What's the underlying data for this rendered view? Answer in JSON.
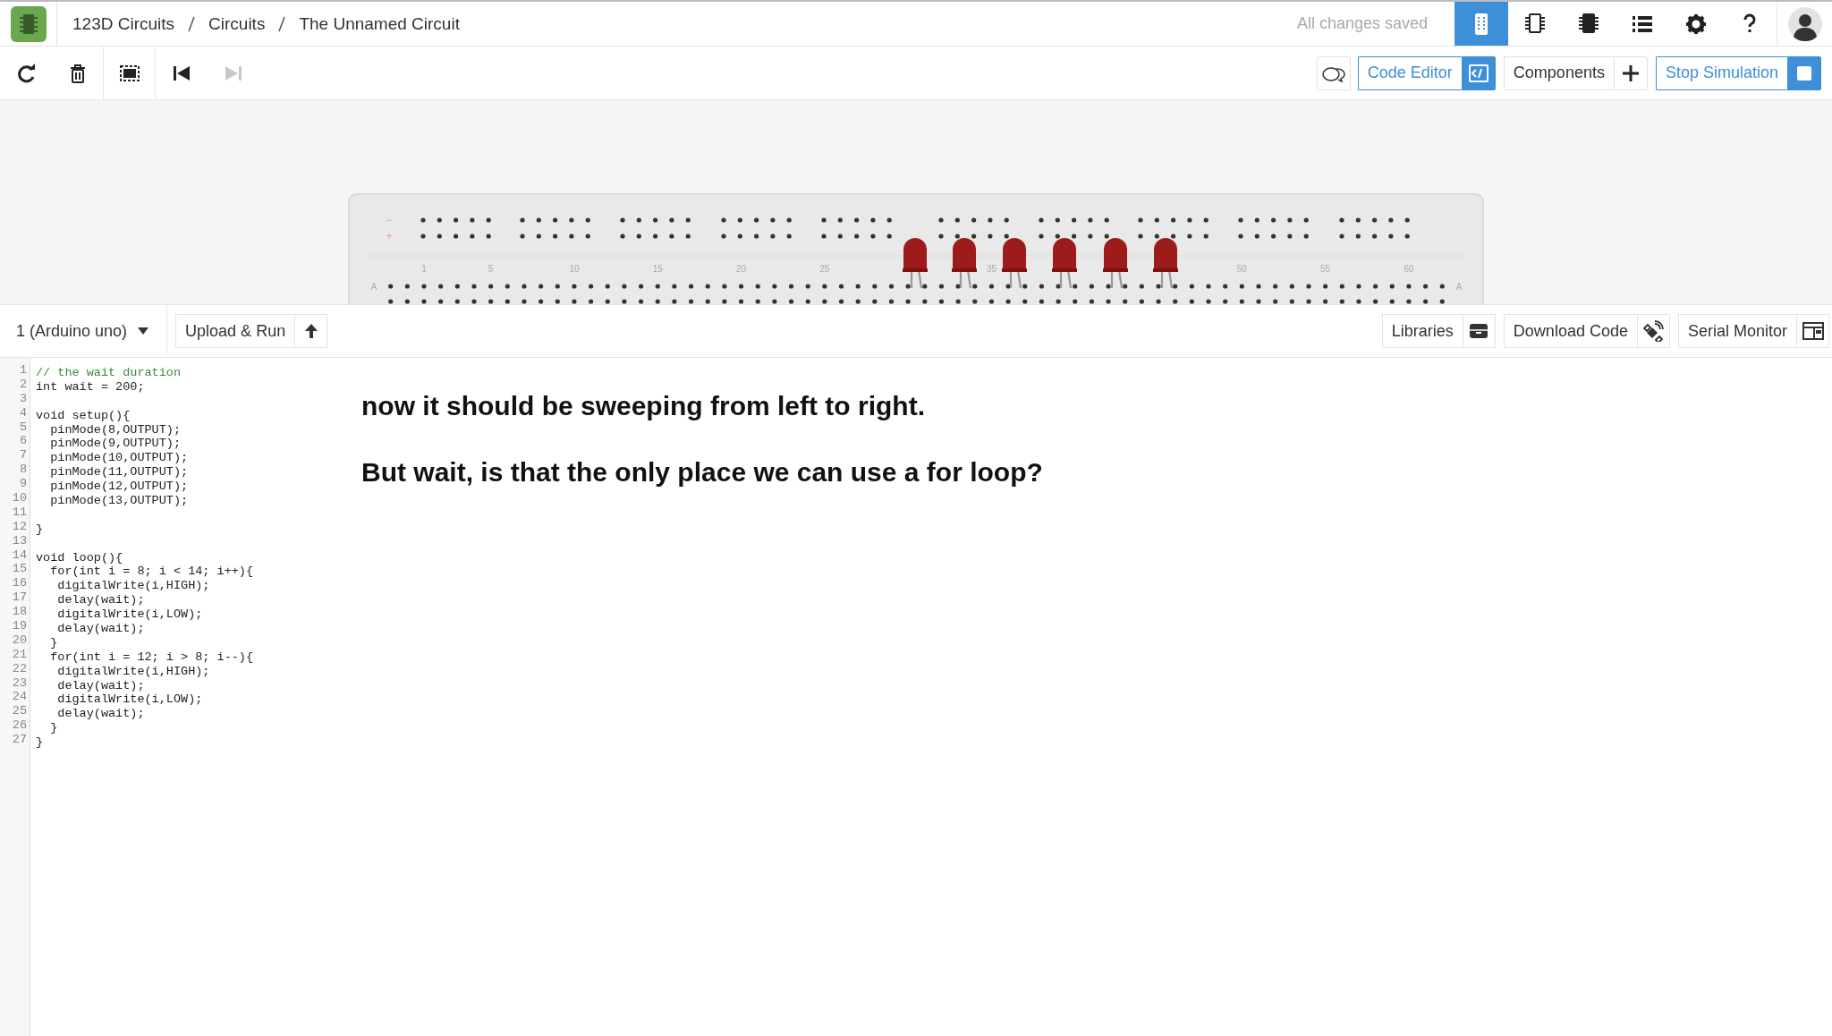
{
  "header": {
    "breadcrumbs": [
      "123D Circuits",
      "Circuits",
      "The Unnamed Circuit"
    ],
    "save_status": "All changes saved",
    "view_buttons": [
      {
        "kind": "breadboard",
        "selected": true
      },
      {
        "kind": "schematic",
        "selected": false
      },
      {
        "kind": "pcb",
        "selected": false
      },
      {
        "kind": "list",
        "selected": false
      },
      {
        "kind": "settings",
        "selected": false
      },
      {
        "kind": "help",
        "selected": false
      },
      {
        "kind": "avatar",
        "selected": false
      }
    ]
  },
  "toolbar": {
    "tools": [
      {
        "kind": "rotate",
        "disabled": false
      },
      {
        "kind": "delete",
        "disabled": false
      },
      {
        "kind": "fit",
        "disabled": false
      },
      {
        "kind": "step-back",
        "disabled": false
      },
      {
        "kind": "step-forward",
        "disabled": true
      }
    ],
    "buttons": [
      {
        "label": "Code Editor",
        "kind": "code",
        "active": true
      },
      {
        "label": "Components",
        "kind": "plus",
        "active": false
      },
      {
        "label": "Stop Simulation",
        "kind": "stop",
        "active": true
      }
    ]
  },
  "breadboard": {
    "rail_labels": [
      "−",
      "+"
    ],
    "row_labels": [
      "A",
      "A"
    ],
    "column_numbers": [
      "1",
      "5",
      "10",
      "15",
      "20",
      "25",
      "35",
      "50",
      "55",
      "60"
    ]
  },
  "code_panel": {
    "board": "1 (Arduino uno)",
    "upload": "Upload & Run",
    "tools": [
      {
        "label": "Libraries",
        "kind": "libraries"
      },
      {
        "label": "Download Code",
        "kind": "download"
      },
      {
        "label": "Serial Monitor",
        "kind": "monitor"
      }
    ],
    "lines": [
      {
        "number": "1",
        "text": "// the wait duration",
        "kind": "comment"
      },
      {
        "number": "2",
        "text": "int wait = 200;",
        "kind": "code"
      },
      {
        "number": "3"
      },
      {
        "number": "4",
        "text": "void setup(){",
        "kind": "code"
      },
      {
        "number": "5",
        "text": "  pinMode(8,OUTPUT);",
        "kind": "code"
      },
      {
        "number": "6",
        "text": "  pinMode(9,OUTPUT);",
        "kind": "code"
      },
      {
        "number": "7",
        "text": "  pinMode(10,OUTPUT);",
        "kind": "code"
      },
      {
        "number": "8",
        "text": "  pinMode(11,OUTPUT);",
        "kind": "code"
      },
      {
        "number": "9",
        "text": "  pinMode(12,OUTPUT);",
        "kind": "code"
      },
      {
        "number": "10",
        "text": "  pinMode(13,OUTPUT);",
        "kind": "code"
      },
      {
        "number": "11"
      },
      {
        "number": "12",
        "text": "}",
        "kind": "code"
      },
      {
        "number": "13"
      },
      {
        "number": "14",
        "text": "void loop(){",
        "kind": "code"
      },
      {
        "number": "15",
        "text": "  for(int i = 8; i < 14; i++){",
        "kind": "code"
      },
      {
        "number": "16",
        "text": "   digitalWrite(i,HIGH);",
        "kind": "code"
      },
      {
        "number": "17",
        "text": "   delay(wait);",
        "kind": "code"
      },
      {
        "number": "18",
        "text": "   digitalWrite(i,LOW);",
        "kind": "code"
      },
      {
        "number": "19",
        "text": "   delay(wait);",
        "kind": "code"
      },
      {
        "number": "20",
        "text": "  }",
        "kind": "code"
      },
      {
        "number": "21",
        "text": "  for(int i = 12; i > 8; i--){",
        "kind": "code"
      },
      {
        "number": "22",
        "text": "   digitalWrite(i,HIGH);",
        "kind": "code"
      },
      {
        "number": "23",
        "text": "   delay(wait);",
        "kind": "code"
      },
      {
        "number": "24",
        "text": "   digitalWrite(i,LOW);",
        "kind": "code"
      },
      {
        "number": "25",
        "text": "   delay(wait);",
        "kind": "code"
      },
      {
        "number": "26",
        "text": "  }",
        "kind": "code"
      },
      {
        "number": "27",
        "text": "}",
        "kind": "code"
      }
    ]
  },
  "notes": [
    "now it should be sweeping from left to right.",
    "But wait, is that the only place we can use a for loop?"
  ]
}
